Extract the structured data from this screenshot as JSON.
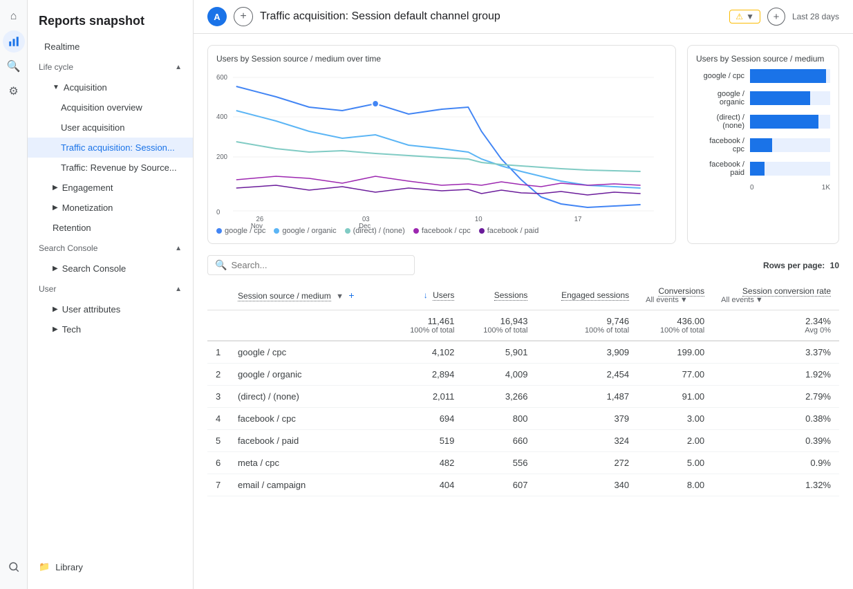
{
  "sidebar": {
    "title": "Reports snapshot",
    "realtime": "Realtime",
    "sections": {
      "lifecycle": "Life cycle",
      "user": "User"
    },
    "acquisition": {
      "label": "Acquisition",
      "items": [
        {
          "label": "Acquisition overview"
        },
        {
          "label": "User acquisition"
        },
        {
          "label": "Traffic acquisition: Session...",
          "active": true
        },
        {
          "label": "Traffic: Revenue by Source..."
        }
      ]
    },
    "engagement": "Engagement",
    "monetization": "Monetization",
    "retention": "Retention",
    "searchConsoleSection": "Search Console",
    "searchConsoleItem": "Search Console",
    "userAttributes": "User attributes",
    "tech": "Tech",
    "library": "Library"
  },
  "header": {
    "avatar": "A",
    "title": "Traffic acquisition: Session default channel group",
    "date": "Last 28 days"
  },
  "chart": {
    "title": "Users by Session source / medium over time",
    "sideTitle": "Users by Session source / medium",
    "xLabels": [
      "26 Nov",
      "03 Dec",
      "10",
      "17"
    ],
    "yLabels": [
      "600",
      "400",
      "200",
      "0"
    ],
    "legend": [
      {
        "label": "google / cpc",
        "color": "#4285f4"
      },
      {
        "label": "google / organic",
        "color": "#5bb5f5"
      },
      {
        "label": "(direct) / (none)",
        "color": "#80cbc4"
      },
      {
        "label": "facebook / cpc",
        "color": "#9c27b0"
      },
      {
        "label": "facebook / paid",
        "color": "#6a1b9a"
      }
    ],
    "bars": [
      {
        "label": "google / cpc",
        "value": 95
      },
      {
        "label": "google /\norganic",
        "value": 75
      },
      {
        "label": "(direct) /\n(none)",
        "value": 88
      },
      {
        "label": "facebook / cpc",
        "value": 30
      },
      {
        "label": "facebook / paid",
        "value": 20
      }
    ]
  },
  "table": {
    "search_placeholder": "Search...",
    "rows_per_page_label": "Rows per page:",
    "rows_per_page_value": "10",
    "columns": {
      "dimension": "Session source / medium",
      "users": "Users",
      "sessions": "Sessions",
      "engaged": "Engaged sessions",
      "conversions": "Conversions",
      "conversion_rate": "Session conversion rate"
    },
    "all_events": "All events",
    "totals": {
      "users": "11,461",
      "users_pct": "100% of total",
      "sessions": "16,943",
      "sessions_pct": "100% of total",
      "engaged": "9,746",
      "engaged_pct": "100% of total",
      "conversions": "436.00",
      "conversions_pct": "100% of total",
      "conv_rate": "2.34%",
      "conv_rate_sub": "Avg 0%"
    },
    "rows": [
      {
        "num": 1,
        "source": "google / cpc",
        "users": "4,102",
        "sessions": "5,901",
        "engaged": "3,909",
        "conversions": "199.00",
        "conv_rate": "3.37%"
      },
      {
        "num": 2,
        "source": "google / organic",
        "users": "2,894",
        "sessions": "4,009",
        "engaged": "2,454",
        "conversions": "77.00",
        "conv_rate": "1.92%"
      },
      {
        "num": 3,
        "source": "(direct) / (none)",
        "users": "2,011",
        "sessions": "3,266",
        "engaged": "1,487",
        "conversions": "91.00",
        "conv_rate": "2.79%"
      },
      {
        "num": 4,
        "source": "facebook / cpc",
        "users": "694",
        "sessions": "800",
        "engaged": "379",
        "conversions": "3.00",
        "conv_rate": "0.38%"
      },
      {
        "num": 5,
        "source": "facebook / paid",
        "users": "519",
        "sessions": "660",
        "engaged": "324",
        "conversions": "2.00",
        "conv_rate": "0.39%"
      },
      {
        "num": 6,
        "source": "meta / cpc",
        "users": "482",
        "sessions": "556",
        "engaged": "272",
        "conversions": "5.00",
        "conv_rate": "0.9%"
      },
      {
        "num": 7,
        "source": "email / campaign",
        "users": "404",
        "sessions": "607",
        "engaged": "340",
        "conversions": "8.00",
        "conv_rate": "1.32%"
      }
    ]
  }
}
